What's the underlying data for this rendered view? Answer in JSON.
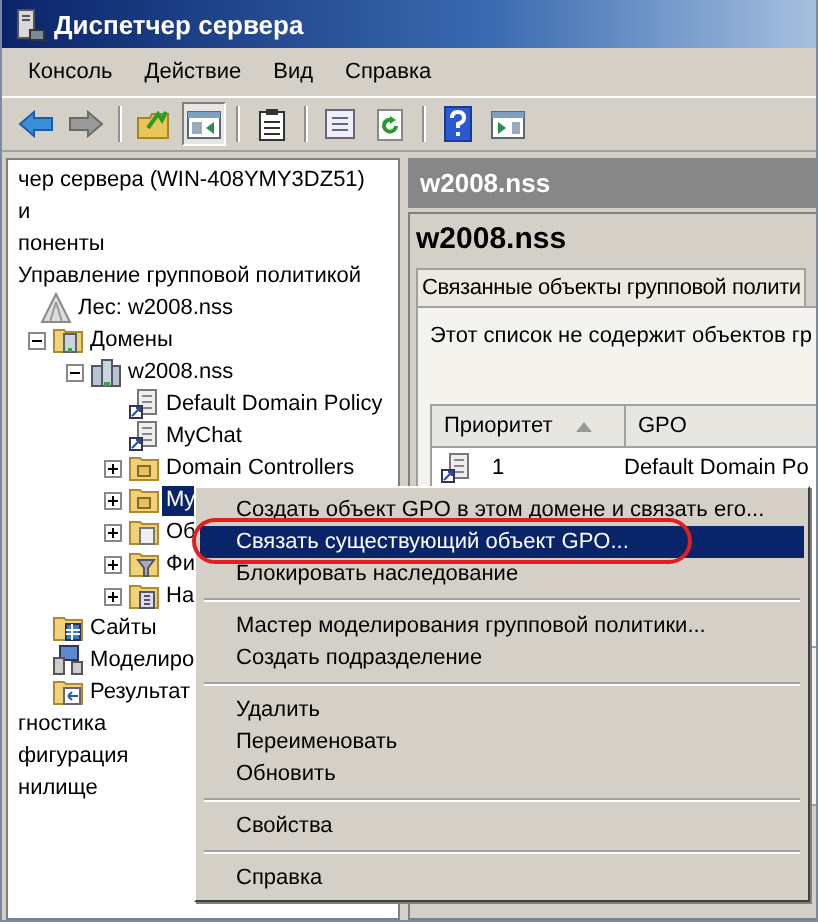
{
  "window": {
    "title": "Диспетчер сервера"
  },
  "menu_bar": [
    "Консоль",
    "Действие",
    "Вид",
    "Справка"
  ],
  "toolbar": [
    {
      "kind": "back",
      "pressed": false
    },
    {
      "kind": "forward",
      "pressed": false
    },
    {
      "kind": "sep"
    },
    {
      "kind": "up",
      "pressed": false
    },
    {
      "kind": "pane",
      "pressed": true
    },
    {
      "kind": "sep"
    },
    {
      "kind": "clipboard",
      "pressed": false
    },
    {
      "kind": "sep"
    },
    {
      "kind": "list",
      "pressed": false
    },
    {
      "kind": "refresh",
      "pressed": false
    },
    {
      "kind": "sep"
    },
    {
      "kind": "help",
      "pressed": false
    },
    {
      "kind": "action",
      "pressed": false
    }
  ],
  "tree": [
    {
      "label": "чер сервера (WIN-408YMY3DZ51)",
      "kind": "text",
      "selected": false
    },
    {
      "label": "и",
      "kind": "text",
      "selected": false
    },
    {
      "label": "поненты",
      "kind": "text",
      "selected": false
    },
    {
      "label": "Управление групповой политикой",
      "kind": "text",
      "selected": false,
      "children": [
        {
          "label": "Лес: w2008.nss",
          "kind": "forest",
          "selected": false,
          "children": [
            {
              "label": "Домены",
              "kind": "domains",
              "expanded": true,
              "selected": false,
              "children": [
                {
                  "label": "w2008.nss",
                  "kind": "domain",
                  "expanded": true,
                  "selected": false,
                  "children": [
                    {
                      "label": "Default Domain Policy",
                      "kind": "gpo",
                      "selected": false
                    },
                    {
                      "label": "MyChat",
                      "kind": "gpo",
                      "selected": false
                    },
                    {
                      "label": "Domain Controllers",
                      "kind": "ou",
                      "expanded": false,
                      "selected": false
                    },
                    {
                      "label": "My",
                      "kind": "ou",
                      "expanded": false,
                      "selected": true
                    },
                    {
                      "label": "Об",
                      "kind": "gpo-folder",
                      "expanded": false,
                      "selected": false
                    },
                    {
                      "label": "Фи",
                      "kind": "filter-folder",
                      "expanded": false,
                      "selected": false
                    },
                    {
                      "label": "На",
                      "kind": "starter-folder",
                      "expanded": false,
                      "selected": false
                    }
                  ]
                }
              ]
            },
            {
              "label": "Сайты",
              "kind": "sites",
              "selected": false
            },
            {
              "label": "Моделиро",
              "kind": "modeling",
              "selected": false
            },
            {
              "label": "Результат",
              "kind": "results",
              "selected": false
            }
          ]
        }
      ]
    },
    {
      "label": "гностика",
      "kind": "text",
      "selected": false
    },
    {
      "label": "фигурация",
      "kind": "text",
      "selected": false
    },
    {
      "label": "нилище",
      "kind": "text",
      "selected": false
    }
  ],
  "details": {
    "header": "w2008.nss",
    "title": "w2008.nss",
    "tab": {
      "label": "Связанные объекты групповой полити",
      "selected": true
    },
    "note": "Этот список не содержит объектов гр",
    "table": {
      "columns": [
        {
          "label": "Приоритет",
          "sort_ascending": true
        },
        {
          "label": "GPO"
        }
      ],
      "rows": [
        {
          "cells": [
            "1",
            "Default Domain Po"
          ]
        }
      ]
    }
  },
  "context_menu": [
    [
      {
        "label": "Создать объект GPO в этом домене и связать его...",
        "selected": false,
        "circled": false
      },
      {
        "label": "Связать существующий объект GPO...",
        "selected": true,
        "circled": true
      },
      {
        "label": "Блокировать наследование",
        "selected": false,
        "circled": false
      }
    ],
    [
      {
        "label": "Мастер моделирования групповой политики...",
        "selected": false,
        "circled": false
      },
      {
        "label": "Создать подразделение",
        "selected": false,
        "circled": false
      }
    ],
    [
      {
        "label": "Удалить",
        "selected": false,
        "circled": false
      },
      {
        "label": "Переименовать",
        "selected": false,
        "circled": false
      },
      {
        "label": "Обновить",
        "selected": false,
        "circled": false
      }
    ],
    [
      {
        "label": "Свойства",
        "selected": false,
        "circled": false
      }
    ],
    [
      {
        "label": "Справка",
        "selected": false,
        "circled": false
      }
    ]
  ]
}
